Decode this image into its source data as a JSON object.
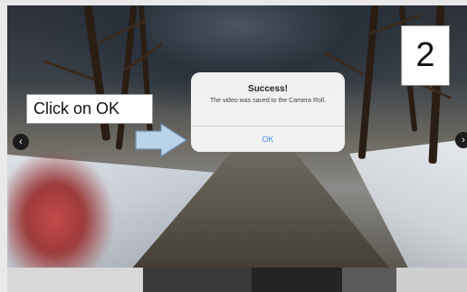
{
  "callout": {
    "text": "Click on OK"
  },
  "step_badge": {
    "number": "2"
  },
  "dialog": {
    "title": "Success!",
    "message": "The video was saved to the Camera Roll.",
    "ok_label": "OK",
    "ok_color": "#4a8fe0"
  },
  "navigation": {
    "prev_icon": "chevron-left-icon",
    "next_icon": "chevron-right-icon",
    "prev_glyph": "‹",
    "next_glyph": "›"
  },
  "colors": {
    "arrow_fill": "#b9d3ea",
    "arrow_stroke": "#6f8fb0"
  }
}
